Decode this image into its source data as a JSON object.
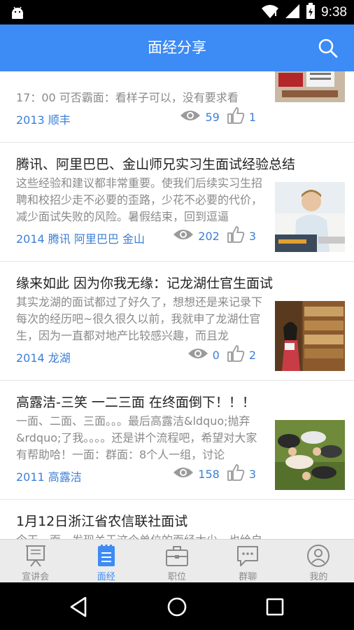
{
  "status": {
    "time": "9:38"
  },
  "app_bar": {
    "title": "面经分享"
  },
  "articles": [
    {
      "title": "",
      "summary": "17：00      可否霸面：看样子可以，没有要求看",
      "tags": "2013 顺丰",
      "views": "59",
      "likes": "1"
    },
    {
      "title": "腾讯、阿里巴巴、金山师兄实习生面试经验总结",
      "summary": "这些经验和建议都非常重要。使我们后续实习生招聘和校招少走不必要的歪路，少花不必要的代价，减少面试失败的风险。暑假结束，回到逗逼",
      "tags": "2014 腾讯 阿里巴巴 金山",
      "views": "202",
      "likes": "3"
    },
    {
      "title": "缘来如此 因为你我无缘：记龙湖仕官生面试",
      "summary": "其实龙湖的面试都过了好久了，想想还是来记录下每次的经历吧~很久很久以前，我就申了龙湖仕官生，因为一直都对地产比较感兴趣，而且龙",
      "tags": "2014 龙湖",
      "views": "0",
      "likes": "2"
    },
    {
      "title": "高露洁-三笑 一二三面 在终面倒下！！！",
      "summary": "一面、二面、三面。。。最后高露洁&ldquo;抛弃&rdquo;了我。。。。还是讲个流程吧，希望对大家有帮助哈！一面：群面：8个人一组，讨论",
      "tags": "2011 高露洁",
      "views": "158",
      "likes": "3"
    },
    {
      "title": "1月12日浙江省农信联社面试",
      "summary": "今天一面，发现关于这个单位的面经太少，也给自己积累些RT，就大致讲讲今天的流程吧。首",
      "tags": "",
      "views": "",
      "likes": ""
    }
  ],
  "tabs": [
    {
      "label": "宣讲会",
      "icon": "presentation-icon"
    },
    {
      "label": "面经",
      "icon": "notepad-icon"
    },
    {
      "label": "职位",
      "icon": "briefcase-icon"
    },
    {
      "label": "群聊",
      "icon": "chat-icon"
    },
    {
      "label": "我的",
      "icon": "profile-icon"
    }
  ],
  "colors": {
    "primary": "#3d8bf4",
    "link": "#3d7fd6",
    "muted": "#8a8a8a"
  }
}
